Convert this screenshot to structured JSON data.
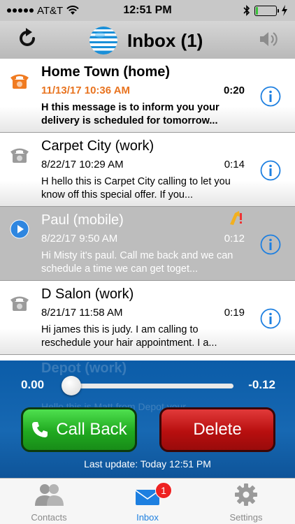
{
  "status_bar": {
    "carrier": "AT&T",
    "time": "12:51 PM",
    "battery_percent": 10
  },
  "nav": {
    "title": "Inbox (1)",
    "icons": [
      "refresh-icon",
      "att-globe-logo",
      "speaker-icon"
    ]
  },
  "messages": [
    {
      "name": "Home Town (home)",
      "date": "11/13/17 10:36 AM",
      "duration": "0:20",
      "text": "H this message is to inform you your delivery is scheduled for tomorrow...",
      "state": "unread",
      "icon": "phone-orange-icon"
    },
    {
      "name": "Carpet City (work)",
      "date": "8/22/17 10:29 AM",
      "duration": "0:14",
      "text": "H hello this is Carpet City calling to let you know off this special offer. If you...",
      "state": "read",
      "icon": "phone-gray-icon"
    },
    {
      "name": "Paul (mobile)",
      "date": "8/22/17 9:50 AM",
      "duration": "0:12",
      "text": "Hi Misty it's paul. Call me back and we can schedule a time we can get toget...",
      "state": "active",
      "icon": "play-icon"
    },
    {
      "name": "D Salon (work)",
      "date": "8/21/17 11:58 AM",
      "duration": "0:19",
      "text": "Hi james this is judy. I am calling to reschedule your hair appointment. I a...",
      "state": "read",
      "icon": "phone-gray-icon"
    }
  ],
  "player": {
    "time_elapsed": "0.00",
    "time_remaining": "-0.12",
    "progress": 0,
    "call_back_label": "Call Back",
    "delete_label": "Delete",
    "last_update": "Last update: Today 12:51 PM",
    "ghost_name": "Depot (work)",
    "ghost_text": "Hello this is Matt from Depot your"
  },
  "tabs": [
    {
      "label": "Contacts",
      "icon": "contacts-icon"
    },
    {
      "label": "Inbox",
      "icon": "mail-icon",
      "badge": "1"
    },
    {
      "label": "Settings",
      "icon": "gear-icon"
    }
  ],
  "colors": {
    "accent_blue": "#1d7fe0",
    "unread_orange": "#e8731f",
    "player_blue": "#1768b2",
    "call_green": "#20a920",
    "delete_red": "#b80f0f"
  }
}
